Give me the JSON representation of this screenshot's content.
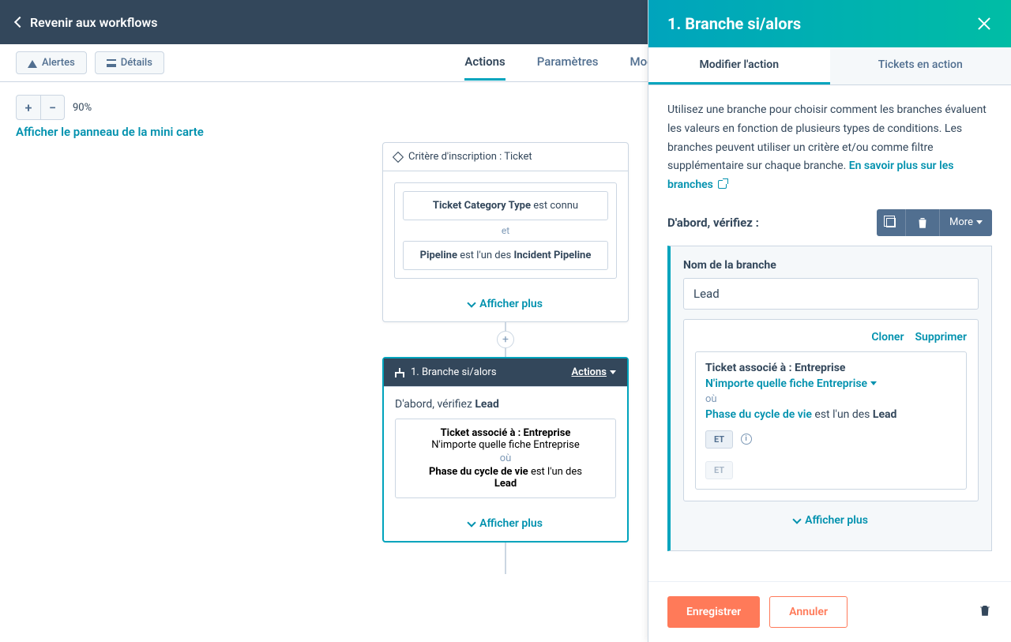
{
  "topBar": {
    "back": "Revenir aux workflows"
  },
  "toolbar": {
    "alerts": "Alertes",
    "details": "Détails",
    "tabs": {
      "actions": "Actions",
      "parametres": "Paramètres",
      "modifications": "Modifications"
    }
  },
  "zoom": {
    "percent": "90%",
    "minimap": "Afficher le panneau de la mini carte"
  },
  "node1": {
    "header": "Critère d'inscription : Ticket",
    "cond1_label": "Ticket Category Type",
    "cond1_op": "est connu",
    "et": "et",
    "cond2_label": "Pipeline",
    "cond2_op": "est l'un des",
    "cond2_val": "Incident Pipeline",
    "showMore": "Afficher plus"
  },
  "node2": {
    "header": "1. Branche si/alors",
    "actions": "Actions",
    "firstCheckPrefix": "D'abord, vérifiez ",
    "firstCheckBold": "Lead",
    "assoc": "Ticket associé à : Entreprise",
    "anyCompany": "N'importe quelle fiche Entreprise",
    "ou": "où",
    "lifecycleLabel": "Phase du cycle de vie",
    "lifecycleOp": "est l'un des",
    "lifecycleVal": "Lead",
    "showMore": "Afficher plus"
  },
  "panel": {
    "title": "1. Branche si/alors",
    "tabs": {
      "edit": "Modifier l'action",
      "tickets": "Tickets en action"
    },
    "desc": "Utilisez une branche pour choisir comment les branches évaluent les valeurs en fonction de plusieurs types de conditions. Les branches peuvent utiliser un critère et/ou comme filtre supplémentaire sur chaque branche. ",
    "learnMore": "En savoir plus sur les branches",
    "verifyLabel": "D'abord, vérifiez :",
    "more": "More",
    "branchNameLabel": "Nom de la branche",
    "branchNameValue": "Lead",
    "clone": "Cloner",
    "delete": "Supprimer",
    "crit": {
      "assoc": "Ticket associé à : Entreprise",
      "anyCompany": "N'importe quelle fiche Entreprise",
      "ou": "où",
      "lifecycleLabel": "Phase du cycle de vie",
      "lifecycleOp": "est l'un des",
      "lifecycleVal": "Lead",
      "et": "ET"
    },
    "showMore": "Afficher plus",
    "save": "Enregistrer",
    "cancel": "Annuler"
  }
}
